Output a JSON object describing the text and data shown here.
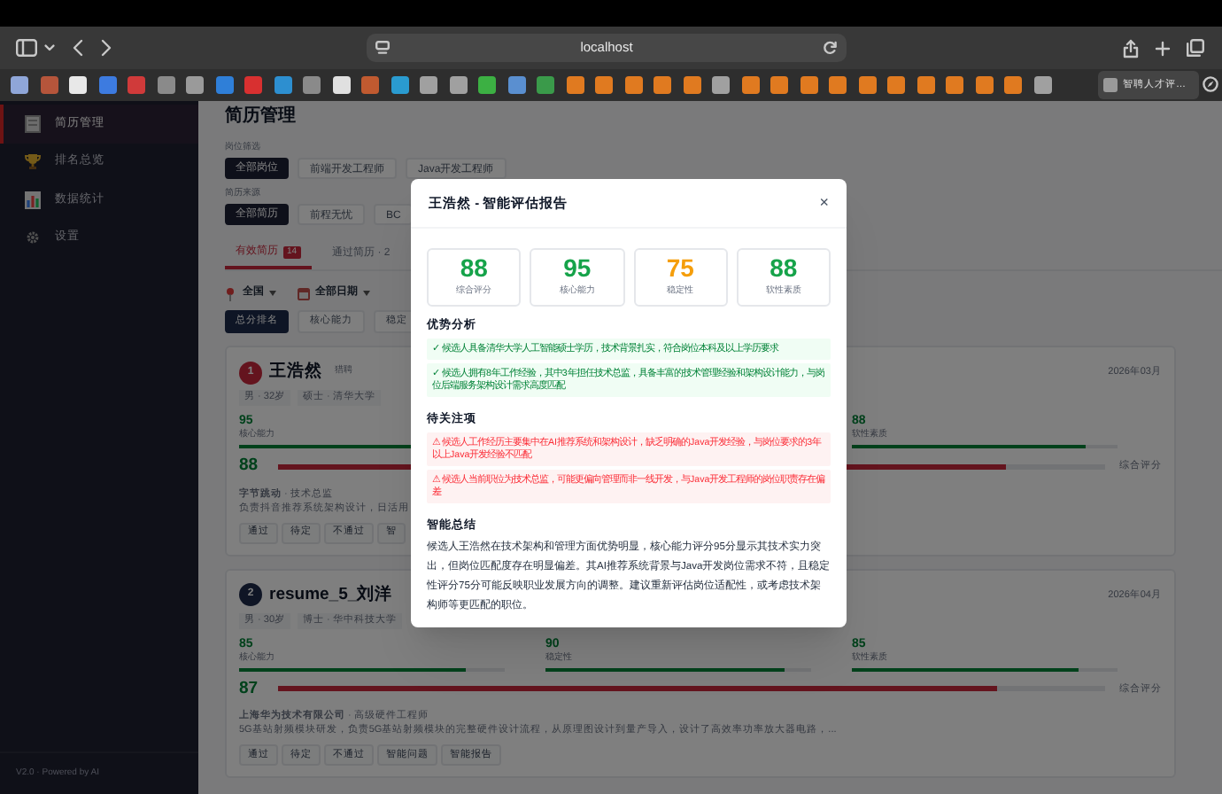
{
  "browser": {
    "address": "localhost",
    "tab": "智聘人才评…"
  },
  "sidebar": {
    "items": [
      {
        "label": "简历管理",
        "selected": true
      },
      {
        "label": "排名总览",
        "selected": false
      },
      {
        "label": "数据统计",
        "selected": false
      },
      {
        "label": "设置",
        "selected": false
      }
    ],
    "footer": "V2.0 · Powered by AI"
  },
  "page": {
    "title": "简历管理",
    "filters": [
      {
        "label": "岗位筛选",
        "options": [
          {
            "label": "全部岗位",
            "selected": true
          },
          {
            "label": "前端开发工程师",
            "selected": false
          },
          {
            "label": "Java开发工程师",
            "selected": false
          }
        ]
      },
      {
        "label": "简历来源",
        "options": [
          {
            "label": "全部简历",
            "selected": true
          },
          {
            "label": "前程无忧",
            "selected": false
          },
          {
            "label": "BC",
            "selected": false
          }
        ]
      }
    ],
    "tabs": [
      {
        "label": "有效简历",
        "badge": "14",
        "selected": true
      },
      {
        "label": "通过简历 · 2",
        "selected": false
      }
    ],
    "dropdowns": [
      {
        "label": "全国"
      },
      {
        "label": "全部日期"
      }
    ],
    "sort": [
      {
        "label": "总分排名",
        "selected": true
      },
      {
        "label": "核心能力",
        "selected": false
      },
      {
        "label": "稳定",
        "selected": false
      }
    ],
    "cards": [
      {
        "rank": "1",
        "name": "王浩然",
        "source": "猎聘",
        "date": "2026年03月",
        "meta": [
          "男 · 32岁",
          "硕士 · 清华大学"
        ],
        "metrics": [
          {
            "value": "95",
            "label": "核心能力",
            "level": 0.95
          },
          {
            "value": "88",
            "label": "软性素质",
            "level": 0.88
          }
        ],
        "overall": {
          "value": "88",
          "label": "综合评分",
          "level": 0.88
        },
        "employment": "**字节跳动** · 技术总监",
        "description": "负责抖音推荐系统架构设计，日活用",
        "actions": [
          "通过",
          "待定",
          "不通过",
          "智"
        ]
      },
      {
        "rank": "2",
        "name": "resume_5_刘洋",
        "date": "2026年04月",
        "meta": [
          "男 · 30岁",
          "博士 · 华中科技大学"
        ],
        "metrics": [
          {
            "value": "85",
            "label": "核心能力",
            "level": 0.85
          },
          {
            "value": "90",
            "label": "稳定性",
            "level": 0.9
          },
          {
            "value": "85",
            "label": "软性素质",
            "level": 0.85
          }
        ],
        "overall": {
          "value": "87",
          "label": "综合评分",
          "level": 0.87
        },
        "employment": "**上海华为技术有限公司** · 高级硬件工程师",
        "description": "5G基站射频模块研发，负责5G基站射频模块的完整硬件设计流程，从原理图设计到量产导入，设计了高效率功率放大器电路，...",
        "actions": [
          "通过",
          "待定",
          "不通过",
          "智能问题",
          "智能报告"
        ]
      }
    ]
  },
  "modal": {
    "title": "王浩然 - 智能评估报告",
    "close": "×",
    "scores": [
      {
        "value": "88",
        "label": "综合评分",
        "color": "#16a34a"
      },
      {
        "value": "95",
        "label": "核心能力",
        "color": "#16a34a"
      },
      {
        "value": "75",
        "label": "稳定性",
        "color": "#f59e0b"
      },
      {
        "value": "88",
        "label": "软性素质",
        "color": "#16a34a"
      }
    ],
    "sections": [
      {
        "kind": "strengths",
        "title": "优势分析",
        "items": [
          "✓ 候选人具备清华大学人工智能硕士学历，技术背景扎实，符合岗位本科及以上学历要求",
          "✓ 候选人拥有8年工作经验，其中3年担任技术总监，具备丰富的技术管理经验和架构设计能力，与岗位后端服务架构设计需求高度匹配"
        ]
      },
      {
        "kind": "concerns",
        "title": "待关注项",
        "items": [
          "⚠ 候选人工作经历主要集中在AI推荐系统和架构设计，缺乏明确的Java开发经验，与岗位要求的3年以上Java开发经验不匹配",
          "⚠ 候选人当前职位为技术总监，可能更偏向管理而非一线开发，与Java开发工程师的岗位职责存在偏差"
        ]
      },
      {
        "kind": "summary",
        "title": "智能总结",
        "text": "候选人王浩然在技术架构和管理方面优势明显，核心能力评分95分显示其技术实力突出，但岗位匹配度存在明显偏差。其AI推荐系统背景与Java开发岗位需求不符，且稳定性评分75分可能反映职业发展方向的调整。建议重新评估岗位适配性，或考虑技术架构师等更匹配的职位。"
      }
    ]
  }
}
